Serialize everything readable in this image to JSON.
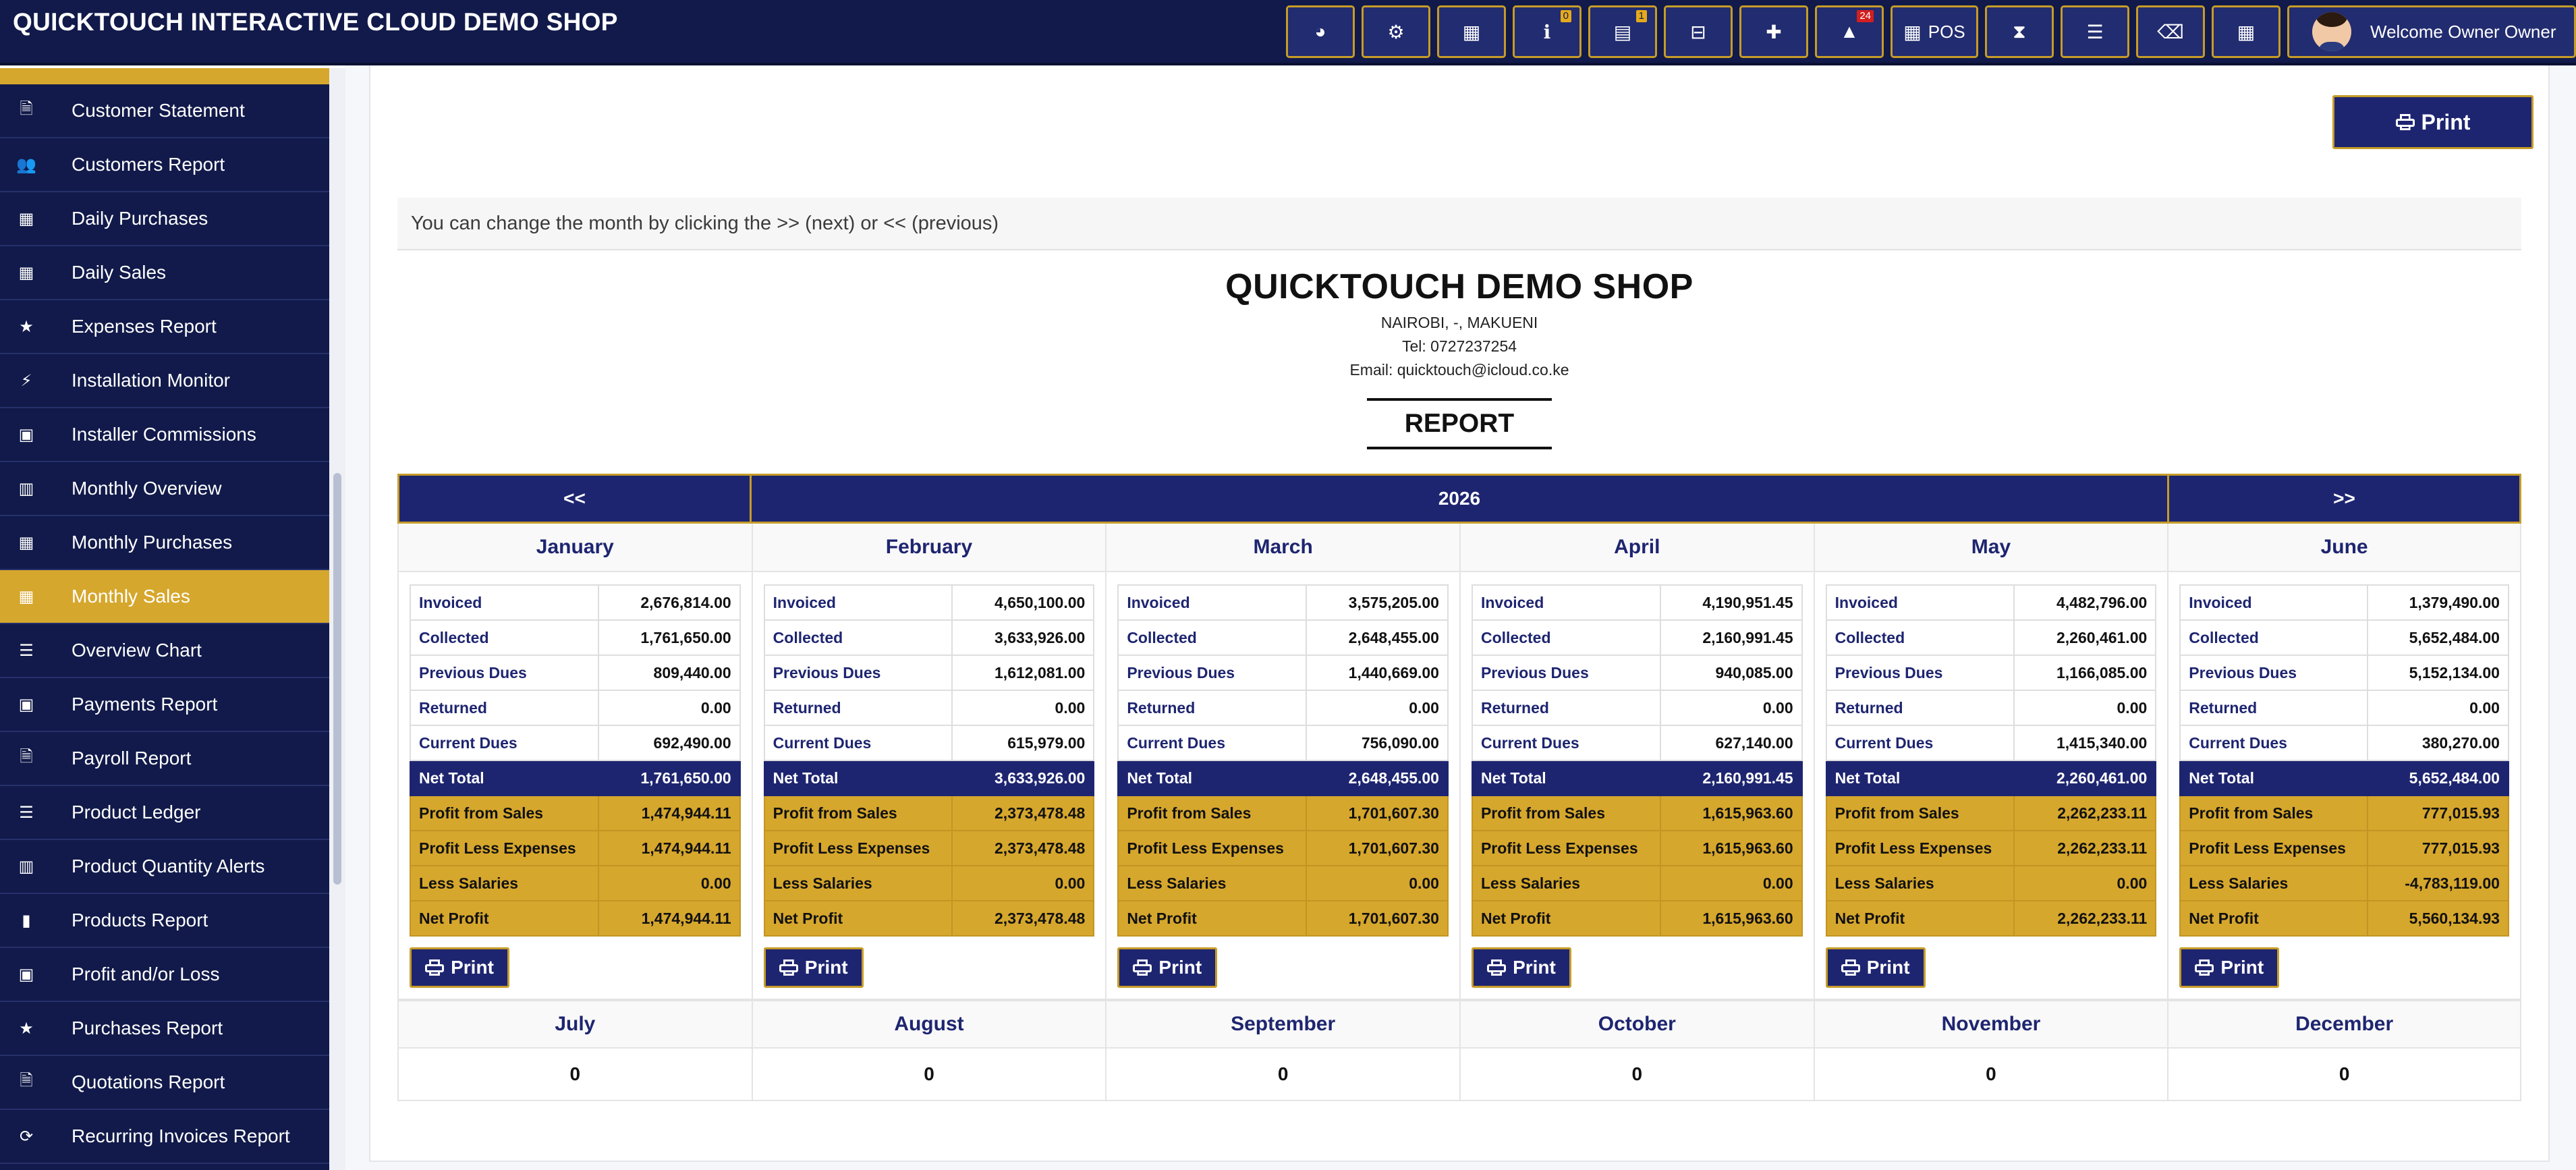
{
  "app": {
    "title": "QUICKTOUCH INTERACTIVE CLOUD DEMO SHOP"
  },
  "toolbar": {
    "buttons": [
      {
        "icon": "dashboard-icon",
        "glyph": "◕"
      },
      {
        "icon": "settings-icon",
        "glyph": "⚙"
      },
      {
        "icon": "calculator-icon",
        "glyph": "▦"
      },
      {
        "icon": "info-icon",
        "glyph": "ℹ",
        "badge": "0"
      },
      {
        "icon": "calendar-icon",
        "glyph": "▤",
        "badge": "1"
      },
      {
        "icon": "cash-drawer-icon",
        "glyph": "⊟"
      },
      {
        "icon": "uk-flag-icon",
        "glyph": "✚"
      },
      {
        "icon": "warning-icon",
        "glyph": "▲",
        "badge": "24"
      },
      {
        "icon": "pos-grid-icon",
        "glyph": "▦",
        "label": "POS"
      },
      {
        "icon": "hourglass-icon",
        "glyph": "⧗"
      },
      {
        "icon": "list-icon",
        "glyph": "☰"
      },
      {
        "icon": "eraser-icon",
        "glyph": "⌫"
      },
      {
        "icon": "apps-grid-icon",
        "glyph": "▦"
      }
    ],
    "user_label": "Welcome Owner Owner"
  },
  "sidebar": {
    "items": [
      {
        "label": "Customer Statement",
        "icon": "document-icon",
        "glyph": "🗎"
      },
      {
        "label": "Customers Report",
        "icon": "users-icon",
        "glyph": "👥"
      },
      {
        "label": "Daily Purchases",
        "icon": "calendar-icon",
        "glyph": "▦"
      },
      {
        "label": "Daily Sales",
        "icon": "calendar-icon",
        "glyph": "▦"
      },
      {
        "label": "Expenses Report",
        "icon": "star-icon",
        "glyph": "★"
      },
      {
        "label": "Installation Monitor",
        "icon": "magic-wand-icon",
        "glyph": "⚡"
      },
      {
        "label": "Installer Commissions",
        "icon": "money-icon",
        "glyph": "▣"
      },
      {
        "label": "Monthly Overview",
        "icon": "bar-chart-icon",
        "glyph": "▥"
      },
      {
        "label": "Monthly Purchases",
        "icon": "calendar-icon",
        "glyph": "▦"
      },
      {
        "label": "Monthly Sales",
        "icon": "calendar-icon",
        "glyph": "▦",
        "active": true
      },
      {
        "label": "Overview Chart",
        "icon": "menu-icon",
        "glyph": "☰"
      },
      {
        "label": "Payments Report",
        "icon": "money-icon",
        "glyph": "▣"
      },
      {
        "label": "Payroll Report",
        "icon": "document-icon",
        "glyph": "🗎"
      },
      {
        "label": "Product Ledger",
        "icon": "list-icon",
        "glyph": "☰"
      },
      {
        "label": "Product Quantity Alerts",
        "icon": "bar-chart-icon",
        "glyph": "▥"
      },
      {
        "label": "Products Report",
        "icon": "barcode-icon",
        "glyph": "▮"
      },
      {
        "label": "Profit and/or Loss",
        "icon": "money-icon",
        "glyph": "▣"
      },
      {
        "label": "Purchases Report",
        "icon": "star-icon",
        "glyph": "★"
      },
      {
        "label": "Quotations Report",
        "icon": "document-icon",
        "glyph": "🗎"
      },
      {
        "label": "Recurring Invoices Report",
        "icon": "refresh-icon",
        "glyph": "⟳"
      }
    ]
  },
  "main": {
    "print_label": "Print",
    "hint": "You can change the month by clicking the >> (next) or << (previous)",
    "shop": {
      "name": "QUICKTOUCH DEMO SHOP",
      "address": "NAIROBI, -, MAKUENI",
      "tel": "Tel: 0727237254",
      "email": "Email: quicktouch@icloud.co.ke",
      "report_label": "REPORT"
    },
    "nav": {
      "prev": "<<",
      "year": "2026",
      "next": ">>"
    },
    "row_labels": [
      "Invoiced",
      "Collected",
      "Previous Dues",
      "Returned",
      "Current Dues",
      "Net Total",
      "Profit from Sales",
      "Profit Less Expenses",
      "Less Salaries",
      "Net Profit"
    ],
    "months": [
      {
        "name": "January",
        "values": [
          "2,676,814.00",
          "1,761,650.00",
          "809,440.00",
          "0.00",
          "692,490.00",
          "1,761,650.00",
          "1,474,944.11",
          "1,474,944.11",
          "0.00",
          "1,474,944.11"
        ]
      },
      {
        "name": "February",
        "values": [
          "4,650,100.00",
          "3,633,926.00",
          "1,612,081.00",
          "0.00",
          "615,979.00",
          "3,633,926.00",
          "2,373,478.48",
          "2,373,478.48",
          "0.00",
          "2,373,478.48"
        ]
      },
      {
        "name": "March",
        "values": [
          "3,575,205.00",
          "2,648,455.00",
          "1,440,669.00",
          "0.00",
          "756,090.00",
          "2,648,455.00",
          "1,701,607.30",
          "1,701,607.30",
          "0.00",
          "1,701,607.30"
        ]
      },
      {
        "name": "April",
        "values": [
          "4,190,951.45",
          "2,160,991.45",
          "940,085.00",
          "0.00",
          "627,140.00",
          "2,160,991.45",
          "1,615,963.60",
          "1,615,963.60",
          "0.00",
          "1,615,963.60"
        ]
      },
      {
        "name": "May",
        "values": [
          "4,482,796.00",
          "2,260,461.00",
          "1,166,085.00",
          "0.00",
          "1,415,340.00",
          "2,260,461.00",
          "2,262,233.11",
          "2,262,233.11",
          "0.00",
          "2,262,233.11"
        ]
      },
      {
        "name": "June",
        "values": [
          "1,379,490.00",
          "5,652,484.00",
          "5,152,134.00",
          "0.00",
          "380,270.00",
          "5,652,484.00",
          "777,015.93",
          "777,015.93",
          "-4,783,119.00",
          "5,560,134.93"
        ]
      }
    ],
    "empty_months": [
      {
        "name": "July",
        "value": "0"
      },
      {
        "name": "August",
        "value": "0"
      },
      {
        "name": "September",
        "value": "0"
      },
      {
        "name": "October",
        "value": "0"
      },
      {
        "name": "November",
        "value": "0"
      },
      {
        "name": "December",
        "value": "0"
      }
    ]
  }
}
